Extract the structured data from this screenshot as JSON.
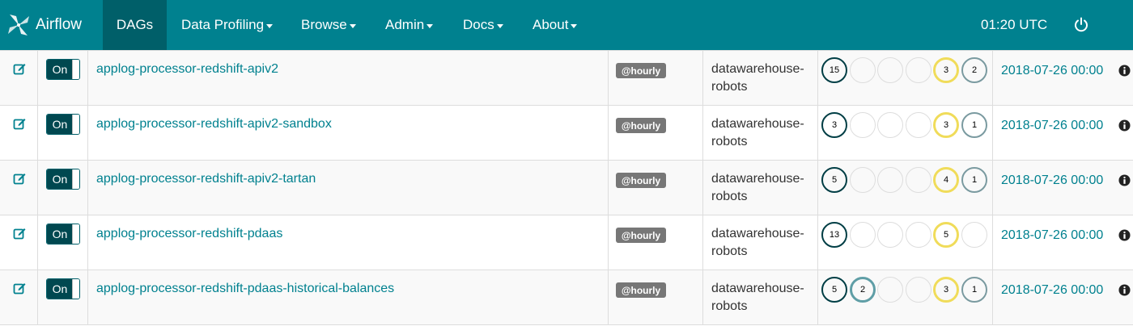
{
  "navbar": {
    "brand": "Airflow",
    "items": [
      {
        "label": "DAGs",
        "active": true,
        "dropdown": false
      },
      {
        "label": "Data Profiling",
        "active": false,
        "dropdown": true
      },
      {
        "label": "Browse",
        "active": false,
        "dropdown": true
      },
      {
        "label": "Admin",
        "active": false,
        "dropdown": true
      },
      {
        "label": "Docs",
        "active": false,
        "dropdown": true
      },
      {
        "label": "About",
        "active": false,
        "dropdown": true
      }
    ],
    "time": "01:20 UTC",
    "power_icon": "power-icon"
  },
  "colors": {
    "navbar": "#00818f",
    "active_nav": "#005f69",
    "link": "#00818f",
    "success": "#003e45",
    "running": "#b0c8cc",
    "upstream": "#f0dc5a",
    "other": "#7a9aa0",
    "empty": "#dddddd"
  },
  "rows": [
    {
      "toggle": "On",
      "dag_id": "applog-processor-redshift-apiv2",
      "schedule": "@hourly",
      "owner": [
        "datawarehouse-",
        "robots"
      ],
      "last_run": "2018-07-26 00:00",
      "runs": [
        {
          "value": "15",
          "color": "#003e45",
          "thick": 2
        },
        {
          "value": "",
          "color": "#dddddd",
          "thick": 1
        },
        {
          "value": "",
          "color": "#dddddd",
          "thick": 1
        },
        {
          "value": "",
          "color": "#dddddd",
          "thick": 1
        },
        {
          "value": "3",
          "color": "#f0dc5a",
          "thick": 3
        },
        {
          "value": "2",
          "color": "#7a9aa0",
          "thick": 2
        }
      ]
    },
    {
      "toggle": "On",
      "dag_id": "applog-processor-redshift-apiv2-sandbox",
      "schedule": "@hourly",
      "owner": [
        "datawarehouse-",
        "robots"
      ],
      "last_run": "2018-07-26 00:00",
      "runs": [
        {
          "value": "3",
          "color": "#003e45",
          "thick": 2
        },
        {
          "value": "",
          "color": "#dddddd",
          "thick": 1
        },
        {
          "value": "",
          "color": "#dddddd",
          "thick": 1
        },
        {
          "value": "",
          "color": "#dddddd",
          "thick": 1
        },
        {
          "value": "3",
          "color": "#f0dc5a",
          "thick": 3
        },
        {
          "value": "1",
          "color": "#7a9aa0",
          "thick": 2
        }
      ]
    },
    {
      "toggle": "On",
      "dag_id": "applog-processor-redshift-apiv2-tartan",
      "schedule": "@hourly",
      "owner": [
        "datawarehouse-",
        "robots"
      ],
      "last_run": "2018-07-26 00:00",
      "runs": [
        {
          "value": "5",
          "color": "#003e45",
          "thick": 2
        },
        {
          "value": "",
          "color": "#dddddd",
          "thick": 1
        },
        {
          "value": "",
          "color": "#dddddd",
          "thick": 1
        },
        {
          "value": "",
          "color": "#dddddd",
          "thick": 1
        },
        {
          "value": "4",
          "color": "#f0dc5a",
          "thick": 3
        },
        {
          "value": "1",
          "color": "#7a9aa0",
          "thick": 2
        }
      ]
    },
    {
      "toggle": "On",
      "dag_id": "applog-processor-redshift-pdaas",
      "schedule": "@hourly",
      "owner": [
        "datawarehouse-",
        "robots"
      ],
      "last_run": "2018-07-26 00:00",
      "runs": [
        {
          "value": "13",
          "color": "#003e45",
          "thick": 2
        },
        {
          "value": "",
          "color": "#dddddd",
          "thick": 1
        },
        {
          "value": "",
          "color": "#dddddd",
          "thick": 1
        },
        {
          "value": "",
          "color": "#dddddd",
          "thick": 1
        },
        {
          "value": "5",
          "color": "#f0dc5a",
          "thick": 3
        },
        {
          "value": "",
          "color": "#dddddd",
          "thick": 1
        }
      ]
    },
    {
      "toggle": "On",
      "dag_id": "applog-processor-redshift-pdaas-historical-balances",
      "schedule": "@hourly",
      "owner": [
        "datawarehouse-",
        "robots"
      ],
      "last_run": "2018-07-26 00:00",
      "runs": [
        {
          "value": "5",
          "color": "#003e45",
          "thick": 2
        },
        {
          "value": "2",
          "color": "#5f9ea6",
          "thick": 3
        },
        {
          "value": "",
          "color": "#dddddd",
          "thick": 1
        },
        {
          "value": "",
          "color": "#dddddd",
          "thick": 1
        },
        {
          "value": "3",
          "color": "#f0dc5a",
          "thick": 3
        },
        {
          "value": "1",
          "color": "#7a9aa0",
          "thick": 2
        }
      ]
    }
  ]
}
